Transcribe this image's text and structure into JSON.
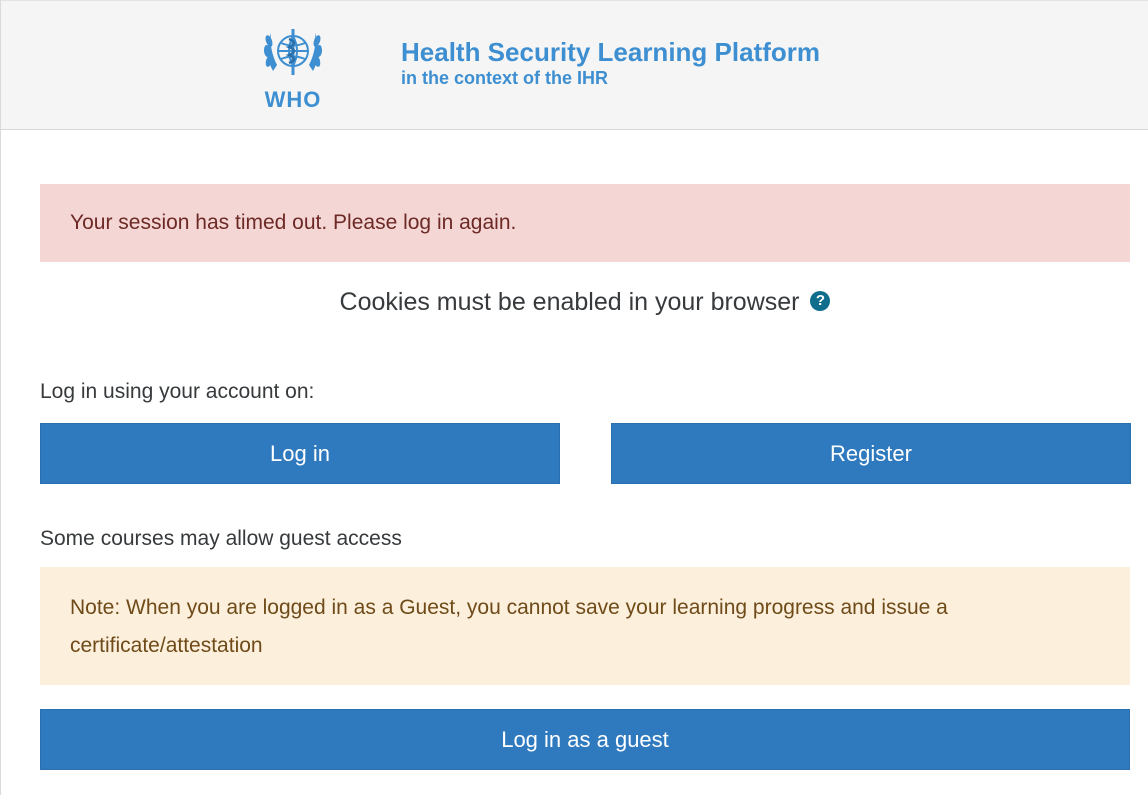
{
  "header": {
    "logo_text": "WHO",
    "title": "Health Security Learning Platform",
    "subtitle": "in the context of the IHR"
  },
  "alerts": {
    "session_timeout": "Your session has timed out. Please log in again.",
    "guest_note": "Note: When you are logged in as a Guest, you cannot save your learning progress and issue a certificate/attestation"
  },
  "cookies": {
    "text": "Cookies must be enabled in your browser",
    "help_icon": "question-circle-icon",
    "help_glyph": "?"
  },
  "login": {
    "using_label": "Log in using your account on:",
    "login_button": "Log in",
    "register_button": "Register",
    "guest_access_label": "Some courses may allow guest access",
    "guest_button": "Log in as a guest"
  },
  "colors": {
    "brand": "#3d8fd1",
    "button": "#2f7abe",
    "error_bg": "#f4d7d4",
    "note_bg": "#fcefdc"
  }
}
